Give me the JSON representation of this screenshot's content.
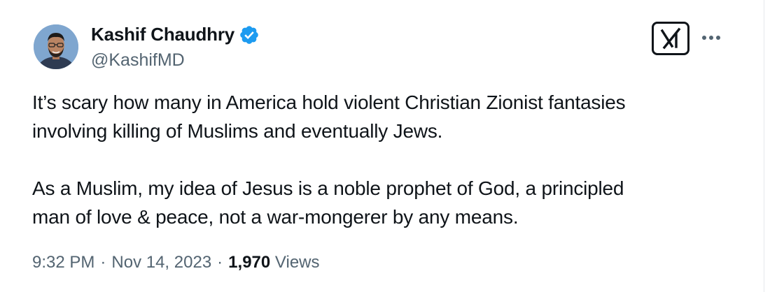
{
  "author": {
    "name": "Kashif Chaudhry",
    "handle": "@KashifMD",
    "verified": true,
    "verified_color": "#1d9bf0"
  },
  "actions": {
    "grok_icon": "grok-icon",
    "more_icon": "more-dots-icon"
  },
  "tweet": {
    "paragraph_1_line_1": "It’s scary how many in America hold violent Christian Zionist fantasies",
    "paragraph_1_line_2": "involving killing of Muslims and eventually Jews.",
    "paragraph_2_line_1": "As a Muslim, my idea of Jesus is a noble prophet of God, a principled",
    "paragraph_2_line_2": "man of love & peace, not a war-mongerer by any means."
  },
  "meta": {
    "time": "9:32 PM",
    "separator": "·",
    "date": "Nov 14, 2023",
    "views_count": "1,970",
    "views_label": "Views"
  },
  "colors": {
    "text": "#0f1419",
    "secondary": "#536471"
  }
}
